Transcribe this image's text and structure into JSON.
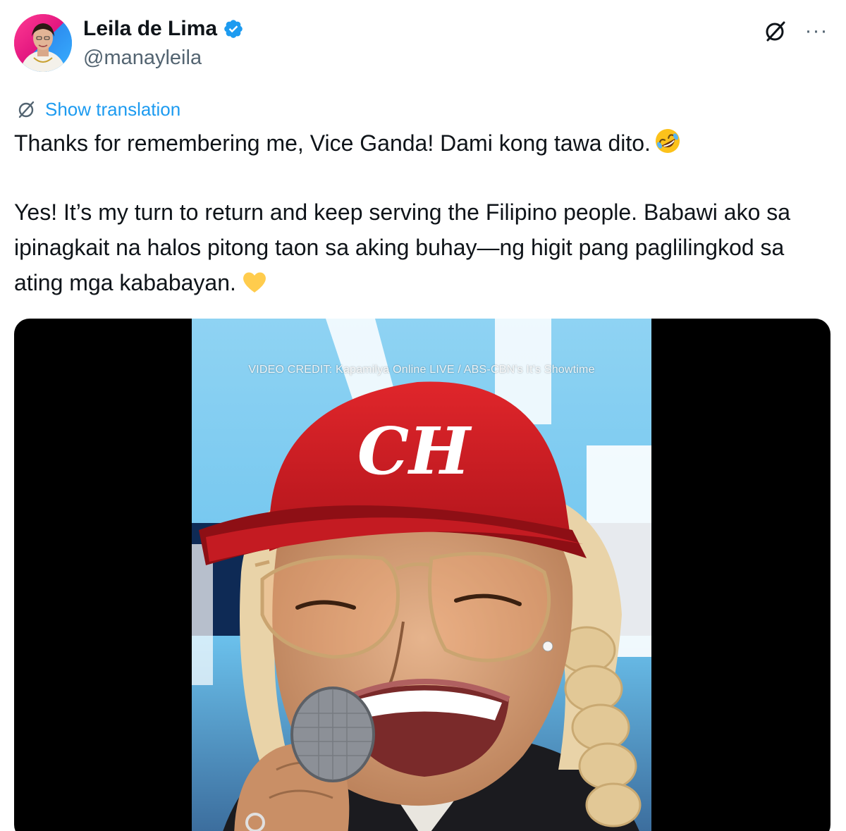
{
  "author": {
    "name": "Leila de Lima",
    "handle": "@manayleila",
    "verified": true
  },
  "header": {
    "grok_icon": "grok-slash-circle-icon",
    "more_label": "···"
  },
  "translation": {
    "label": "Show translation"
  },
  "tweet": {
    "paragraph_1": "Thanks for remembering me, Vice Ganda! Dami kong tawa dito.",
    "paragraph_1_emoji": "rolling-on-floor-laughing-emoji",
    "paragraph_2": "Yes! It’s my turn to return and keep serving the Filipino people. Babawi ako sa ipinagkait na halos pitong taon sa aking buhay—ng higit pang paglilingkod sa ating mga kababayan.",
    "paragraph_2_emoji": "yellow-heart-emoji"
  },
  "media": {
    "video_credit": "VIDEO CREDIT: Kapamilya Online LIVE / ABS-CBN's It's Showtime",
    "cap_logo": "CH"
  },
  "colors": {
    "link": "#1d9bf0",
    "text": "#0f1419",
    "secondary": "#536471",
    "verified": "#1d9bf0"
  }
}
